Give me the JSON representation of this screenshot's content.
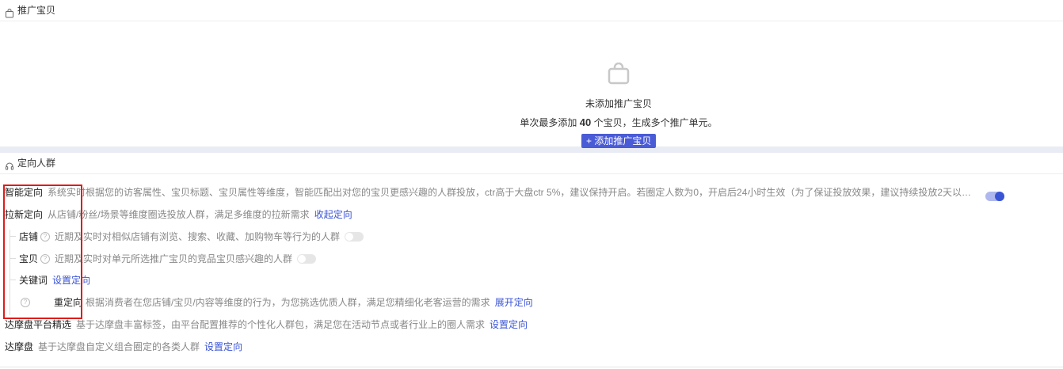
{
  "promo_section": {
    "title": "推广宝贝",
    "icon": "bag-icon",
    "empty_title": "未添加推广宝贝",
    "empty_desc_prefix": "单次最多添加 ",
    "empty_desc_count": "40",
    "empty_desc_suffix": " 个宝贝，生成多个推广单元。",
    "add_button_label": "+ 添加推广宝贝",
    "accent_color": "#4a5bd6"
  },
  "targeting_section": {
    "title": "定向人群",
    "icon": "headset-icon",
    "smart": {
      "label": "智能定向",
      "desc": "系统实时根据您的访客属性、宝贝标题、宝贝属性等维度，智能匹配出对您的宝贝更感兴趣的人群投放，ctr高于大盘ctr 5%，建议保持开启。若圈定人数为0，开启后24小时生效（为了保证投放效果，建议持续投放2天以…",
      "enabled": true
    },
    "acquire": {
      "label": "拉新定向",
      "desc": "从店铺/粉丝/场景等维度圈选投放人群，满足多维度的拉新需求",
      "link": "收起定向"
    },
    "shop": {
      "label": "店铺",
      "desc": "近期及实时对相似店铺有浏览、搜索、收藏、加购物车等行为的人群",
      "enabled": false
    },
    "item": {
      "label": "宝贝",
      "desc": "近期及实时对单元所选推广宝贝的竞品宝贝感兴趣的人群",
      "enabled": false
    },
    "keyword": {
      "label": "关键词",
      "link": "设置定向"
    },
    "retarget": {
      "label": "重定向",
      "desc": "根据消费者在您店铺/宝贝/内容等维度的行为，为您挑选优质人群，满足您精细化老客运营的需求",
      "link": "展开定向"
    },
    "damo_select": {
      "label": "达摩盘平台精选",
      "desc": "基于达摩盘丰富标签，由平台配置推荐的个性化人群包，满足您在活动节点或者行业上的圈人需求",
      "link": "设置定向"
    },
    "damo": {
      "label": "达摩盘",
      "desc": "基于达摩盘自定义组合圈定的各类人群",
      "link": "设置定向"
    },
    "link_color": "#3a54d6",
    "highlight_color": "#e01b1b"
  }
}
